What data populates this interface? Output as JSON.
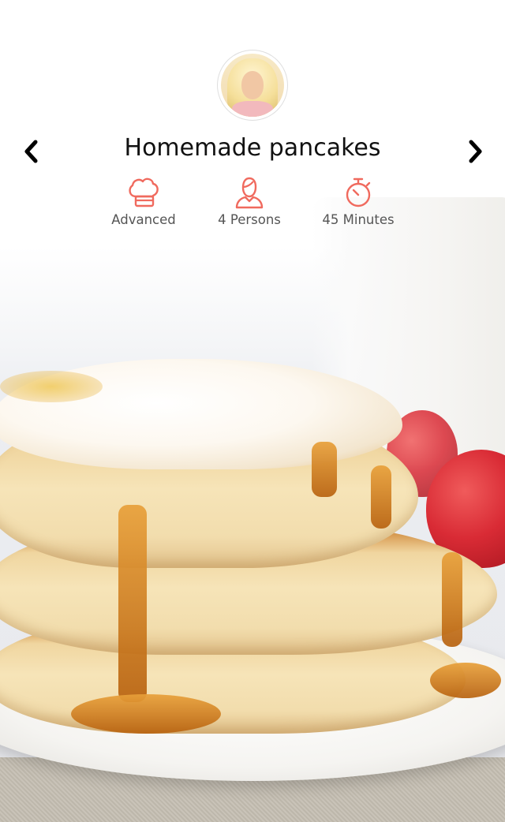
{
  "recipe": {
    "title": "Homemade pancakes",
    "stats": [
      {
        "icon": "chef-hat-icon",
        "label": "Advanced"
      },
      {
        "icon": "person-icon",
        "label": "4 Persons"
      },
      {
        "icon": "stopwatch-icon",
        "label": "45 Minutes"
      }
    ]
  },
  "navigation": {
    "prev_icon": "chevron-left-icon",
    "next_icon": "chevron-right-icon"
  },
  "colors": {
    "accent": "#F06A5E",
    "title": "#111111",
    "label": "#555555"
  }
}
